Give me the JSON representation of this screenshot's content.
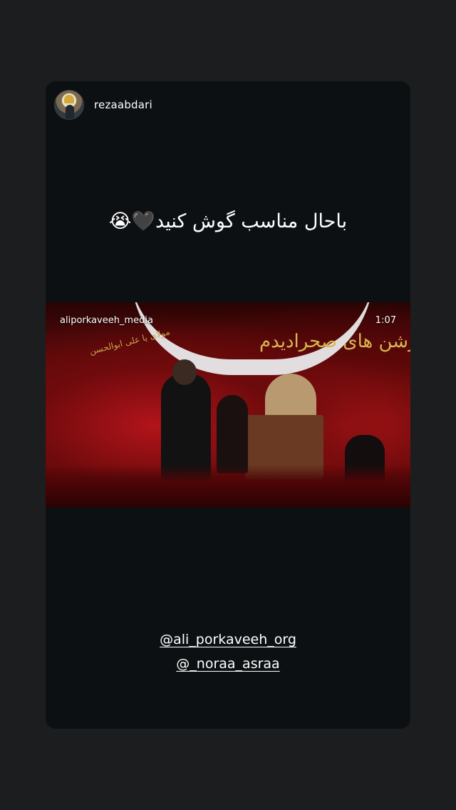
{
  "story": {
    "username": "rezaabdari",
    "caption": "باحال مناسب گوش کنید🖤😭",
    "video": {
      "source_account": "aliporkaveeh_media",
      "duration": "1:07",
      "banner_text": "ز ابرشن های صحرادیدم",
      "banner_small_text": "مولای یا علی ابوالحسن"
    },
    "mentions": [
      "@ali_porkaveeh_org",
      "@_noraa_asraa"
    ]
  },
  "colors": {
    "page_bg": "#1c1d1f",
    "card_bg": "#0d1012",
    "text": "#ffffff",
    "video_red": "#b2141a",
    "gold": "#d8b650"
  },
  "icons": {
    "avatar": "profile-photo"
  }
}
